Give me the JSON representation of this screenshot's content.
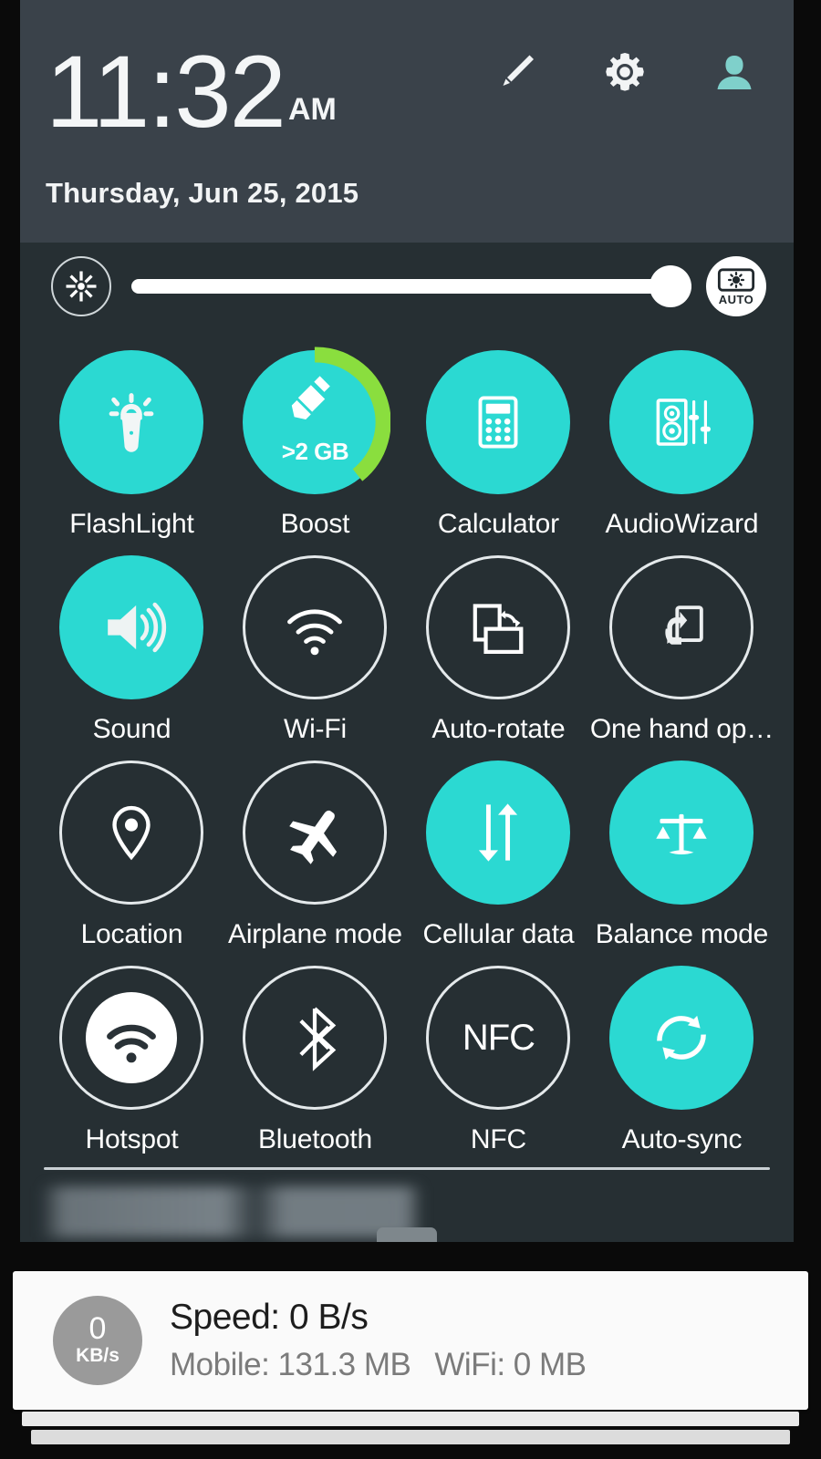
{
  "status_panel": {
    "clock": {
      "time": "11:32",
      "ampm": "AM",
      "date": "Thursday, Jun 25, 2015"
    },
    "header_icons": [
      {
        "name": "edit-pencil-icon",
        "label": "Edit"
      },
      {
        "name": "settings-gear-icon",
        "label": "Settings"
      },
      {
        "name": "user-profile-icon",
        "label": "User"
      }
    ],
    "brightness": {
      "icon_label": "Brightness",
      "value_percent": 93,
      "auto_label": "AUTO"
    },
    "toggles": [
      {
        "label": "FlashLight",
        "icon": "flashlight-icon",
        "state": "on"
      },
      {
        "label": "Boost",
        "icon": "broom-boost-icon",
        "state": "on",
        "badge": ">2 GB",
        "ring_percent": 45
      },
      {
        "label": "Calculator",
        "icon": "calculator-icon",
        "state": "on"
      },
      {
        "label": "AudioWizard",
        "icon": "audio-wizard-icon",
        "state": "on"
      },
      {
        "label": "Sound",
        "icon": "speaker-icon",
        "state": "on"
      },
      {
        "label": "Wi-Fi",
        "icon": "wifi-icon",
        "state": "off"
      },
      {
        "label": "Auto-rotate",
        "icon": "auto-rotate-icon",
        "state": "off"
      },
      {
        "label": "One hand op…",
        "icon": "one-hand-icon",
        "state": "off"
      },
      {
        "label": "Location",
        "icon": "location-pin-icon",
        "state": "off"
      },
      {
        "label": "Airplane mode",
        "icon": "airplane-icon",
        "state": "off"
      },
      {
        "label": "Cellular data",
        "icon": "data-arrows-icon",
        "state": "on"
      },
      {
        "label": "Balance mode",
        "icon": "scales-icon",
        "state": "on"
      },
      {
        "label": "Hotspot",
        "icon": "hotspot-icon",
        "state": "off"
      },
      {
        "label": "Bluetooth",
        "icon": "bluetooth-icon",
        "state": "off"
      },
      {
        "label": "NFC",
        "icon": "nfc-icon",
        "state": "off",
        "glyph": "NFC"
      },
      {
        "label": "Auto-sync",
        "icon": "sync-arrows-icon",
        "state": "on"
      }
    ]
  },
  "notification": {
    "badge_value": "0",
    "badge_unit": "KB/s",
    "title": "Speed: 0 B/s",
    "mobile": "Mobile: 131.3 MB",
    "wifi": "WiFi: 0 MB"
  },
  "colors": {
    "accent_teal": "#2bd9d2",
    "boost_green": "#8ade3e",
    "panel_bg": "#262f33",
    "header_bg": "#3a424a",
    "text_white": "#ffffff"
  }
}
